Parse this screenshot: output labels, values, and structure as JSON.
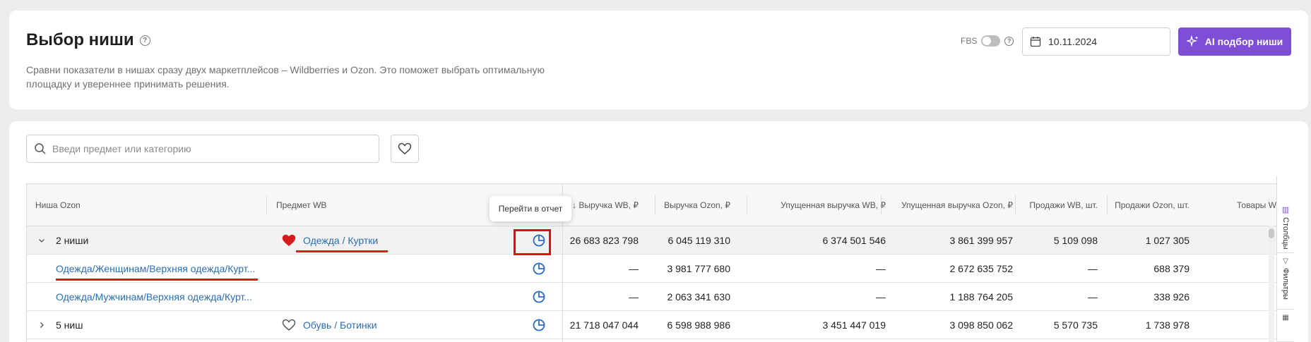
{
  "header": {
    "title": "Выбор ниши",
    "help": "?",
    "subtitle": "Сравни показатели в нишах сразу двух маркетплейсов – Wildberries и Ozon. Это поможет выбрать оптимальную площадку и увереннее принимать решения.",
    "fbs_label": "FBS",
    "fbs_on": false,
    "date": "10.11.2024",
    "ai_button": "AI подбор ниши",
    "accent_color": "#7e4fd6"
  },
  "search": {
    "placeholder": "Введи предмет или категорию"
  },
  "table": {
    "columns": {
      "niche_ozon": "Ниша Ozon",
      "subject_wb": "Предмет WB",
      "revenue_wb": "↓ Выручка WB, ₽",
      "revenue_ozon": "Выручка Ozon, ₽",
      "lost_wb": "Упущенная выручка WB, ₽",
      "lost_ozon": "Упущенная выручка Ozon, ₽",
      "sales_wb": "Продажи WB, шт.",
      "sales_ozon": "Продажи Ozon, шт.",
      "goods": "Товары W"
    },
    "rows": [
      {
        "niche": "2 ниши",
        "subject": "Одежда / Куртки",
        "revenue_wb": "26 683 823 798",
        "revenue_ozon": "6 045 119 310",
        "lost_wb": "6 374 501 546",
        "lost_ozon": "3 861 399 957",
        "sales_wb": "5 109 098",
        "sales_ozon": "1 027 305"
      },
      {
        "niche": "Одежда/Женщинам/Верхняя одежда/Курт...",
        "revenue_wb": "—",
        "revenue_ozon": "3 981 777 680",
        "lost_wb": "—",
        "lost_ozon": "2 672 635 752",
        "sales_wb": "—",
        "sales_ozon": "688 379"
      },
      {
        "niche": "Одежда/Мужчинам/Верхняя одежда/Курт...",
        "revenue_wb": "—",
        "revenue_ozon": "2 063 341 630",
        "lost_wb": "—",
        "lost_ozon": "1 188 764 205",
        "sales_wb": "—",
        "sales_ozon": "338 926"
      },
      {
        "niche": "5 ниш",
        "subject": "Обувь / Ботинки",
        "revenue_wb": "21 718 047 044",
        "revenue_ozon": "6 598 988 986",
        "lost_wb": "3 451 447 019",
        "lost_ozon": "3 098 850 062",
        "sales_wb": "5 570 735",
        "sales_ozon": "1 738 978"
      }
    ]
  },
  "tooltip": "Перейти в отчет",
  "sidebar": {
    "columns": "Столбцы",
    "filters": "Фильтры"
  }
}
